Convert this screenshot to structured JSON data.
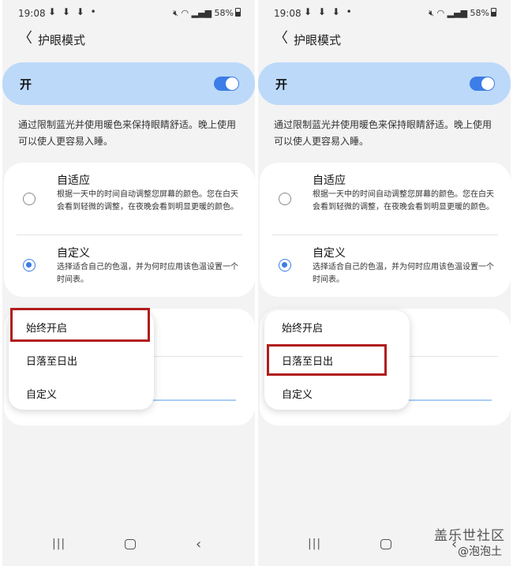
{
  "status": {
    "time": "19:08",
    "download_icons": "⬇ ⬇ ⬇ •",
    "battery": "58%"
  },
  "header": {
    "title": "护眼模式"
  },
  "master": {
    "label": "开"
  },
  "description": "通过限制蓝光并使用暖色来保持眼睛舒适。晚上使用可以使人更容易入睡。",
  "options": [
    {
      "title": "自适应",
      "subtitle": "根据一天中的时间自动调整您屏幕的颜色。您在白天会看到轻微的调整，在夜晚会看到明显更暖的颜色。"
    },
    {
      "title": "自定义",
      "subtitle": "选择适合自己的色温，并为何时应用该色温设置一个时间表。"
    }
  ],
  "menu": {
    "items": [
      "始终开启",
      "日落至日出",
      "自定义"
    ]
  },
  "watermark": {
    "line1": "盖乐世社区",
    "line2": "@泡泡土"
  },
  "colors": {
    "accent": "#3c7de7",
    "master_bg": "#bcd9fa",
    "highlight": "#b11c1c"
  },
  "icons": {
    "back": "chevron-left-icon",
    "recent": "recent-apps-icon",
    "home": "home-icon",
    "nav_back": "nav-back-icon"
  }
}
